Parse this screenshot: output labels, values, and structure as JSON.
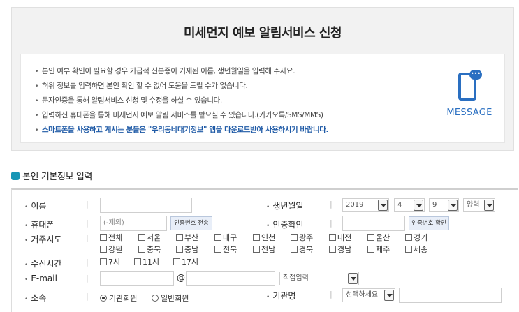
{
  "notice": {
    "title": "미세먼지 예보 알림서비스 신청",
    "bullet": "•",
    "items": [
      "본인 여부 확인이 필요할 경우 가급적 신분증이 기재된 이름, 생년월일을 입력해 주세요.",
      "허위 정보를 입력하면 본인 확인 할 수 없어 도움을 드릴 수가 없습니다.",
      "문자인증을 통해 알림서비스 신청 및 수정을 하실 수 있습니다.",
      "입력하신 휴대폰을 통해 미세먼지 예보 알림 서비스를 받으실 수 있습니다.(카카오톡/SMS/MMS)",
      "스마트폰을 사용하고 계시는 분들은 \"우리동네대기정보\" 앱을 다운로드받아 사용하시기 바랍니다."
    ],
    "message_label": "MESSAGE",
    "bubble": "•••"
  },
  "section": {
    "title": "본인 기본정보 입력"
  },
  "form": {
    "bullet": "•",
    "sep": "|",
    "name_label": "이름",
    "birth_label": "생년월일",
    "birth_year": "2019",
    "birth_month": "4",
    "birth_day": "9",
    "calendar": "양력",
    "phone_label": "휴대폰",
    "phone_placeholder": "(-제외)",
    "send_code_button": "인증번호 전송",
    "verify_label": "인증확인",
    "verify_button": "인증번호 확인",
    "region_label": "거주시도",
    "regions_row1": [
      "전체",
      "서울",
      "부산",
      "대구",
      "인천",
      "광주",
      "대전",
      "울산",
      "경기"
    ],
    "regions_row2": [
      "강원",
      "충북",
      "충남",
      "전북",
      "전남",
      "경북",
      "경남",
      "제주",
      "세종"
    ],
    "time_label": "수신시간",
    "times": [
      "7시",
      "11시",
      "17시"
    ],
    "email_label": "E-mail",
    "at": "@",
    "email_domain_select": "직접입력",
    "affil_label": "소속",
    "affil_options": [
      "기관회원",
      "일반회원"
    ],
    "org_label": "기관명",
    "org_select": "선택하세요"
  },
  "colors": {
    "accent": "#2a6fc1",
    "section_icon": "#1796b6",
    "highlight": "#1f5aa6"
  }
}
